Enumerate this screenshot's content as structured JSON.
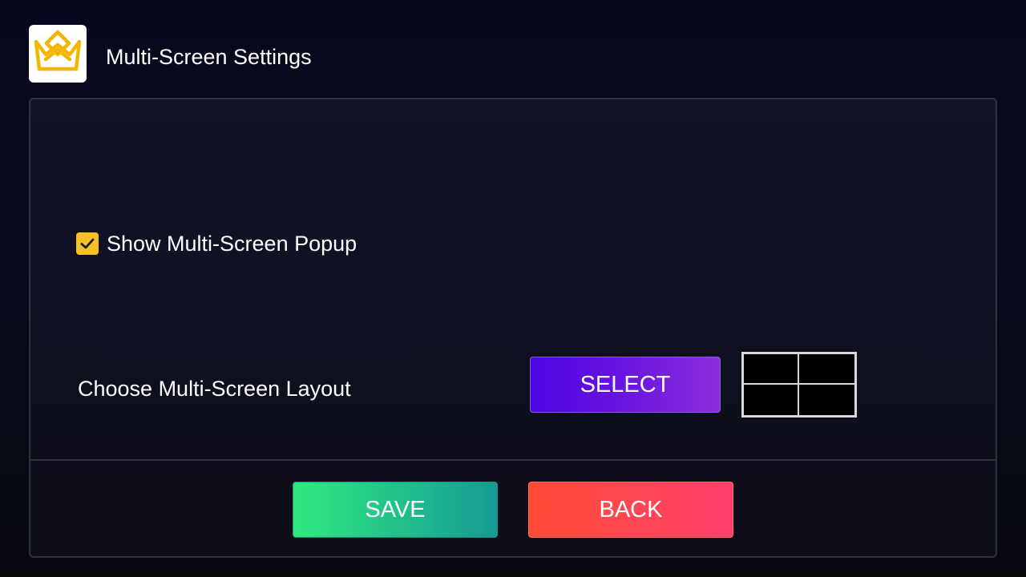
{
  "header": {
    "title": "Multi-Screen Settings",
    "logo_icon": "crown-logo-icon"
  },
  "settings": {
    "show_popup": {
      "label": "Show Multi-Screen Popup",
      "checked": true
    },
    "layout": {
      "label": "Choose Multi-Screen Layout",
      "select_label": "SELECT",
      "preview_icon": "quad-grid-layout-icon"
    }
  },
  "footer": {
    "save_label": "SAVE",
    "back_label": "BACK"
  },
  "colors": {
    "accent": "#f5c125",
    "select_gradient_start": "#4d05e2",
    "select_gradient_end": "#8a2edc",
    "save_gradient_start": "#2fe97e",
    "save_gradient_end": "#169a92",
    "back_gradient_start": "#ff4a34",
    "back_gradient_end": "#ff3f6a"
  }
}
